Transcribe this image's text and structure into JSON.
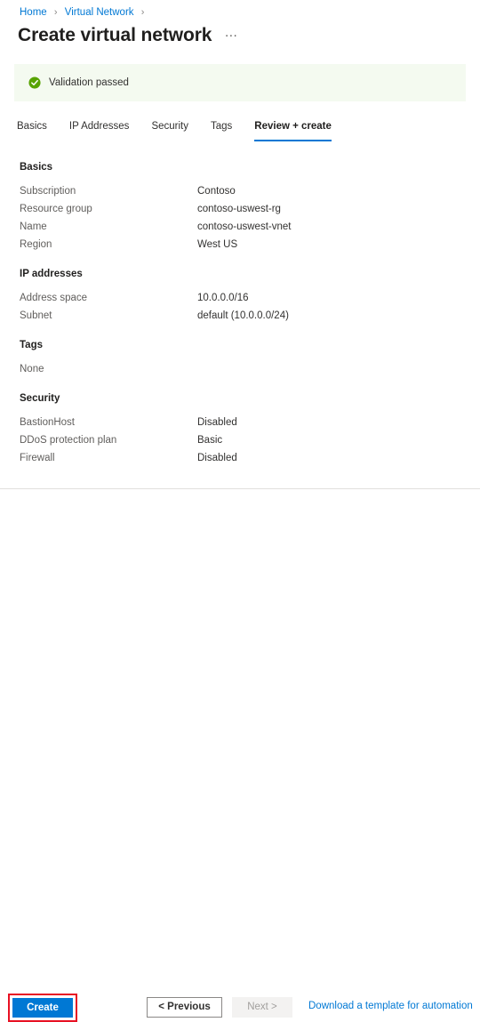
{
  "breadcrumb": {
    "items": [
      {
        "label": "Home"
      },
      {
        "label": "Virtual Network"
      }
    ],
    "separator": "›"
  },
  "header": {
    "title": "Create virtual network",
    "more_label": "…"
  },
  "validation": {
    "text": "Validation passed",
    "icon": "check-circle-icon",
    "background_color": "#f4faf0",
    "icon_color": "#57a300"
  },
  "tabs": [
    {
      "label": "Basics",
      "active": false
    },
    {
      "label": "IP Addresses",
      "active": false
    },
    {
      "label": "Security",
      "active": false
    },
    {
      "label": "Tags",
      "active": false
    },
    {
      "label": "Review + create",
      "active": true
    }
  ],
  "sections": [
    {
      "heading": "Basics",
      "rows": [
        {
          "label": "Subscription",
          "value": "Contoso"
        },
        {
          "label": "Resource group",
          "value": "contoso-uswest-rg"
        },
        {
          "label": "Name",
          "value": "contoso-uswest-vnet"
        },
        {
          "label": "Region",
          "value": "West US"
        }
      ]
    },
    {
      "heading": "IP addresses",
      "rows": [
        {
          "label": "Address space",
          "value": "10.0.0.0/16"
        },
        {
          "label": "Subnet",
          "value": "default (10.0.0.0/24)"
        }
      ]
    },
    {
      "heading": "Tags",
      "text": "None",
      "rows": []
    },
    {
      "heading": "Security",
      "rows": [
        {
          "label": "BastionHost",
          "value": "Disabled"
        },
        {
          "label": "DDoS protection plan",
          "value": "Basic"
        },
        {
          "label": "Firewall",
          "value": "Disabled"
        }
      ]
    }
  ],
  "footer": {
    "create_label": "Create",
    "previous_label": "< Previous",
    "next_label": "Next >",
    "template_link_label": "Download a template for automation",
    "next_disabled": true,
    "highlight_color": "#e81123",
    "primary_color": "#0078d4"
  }
}
